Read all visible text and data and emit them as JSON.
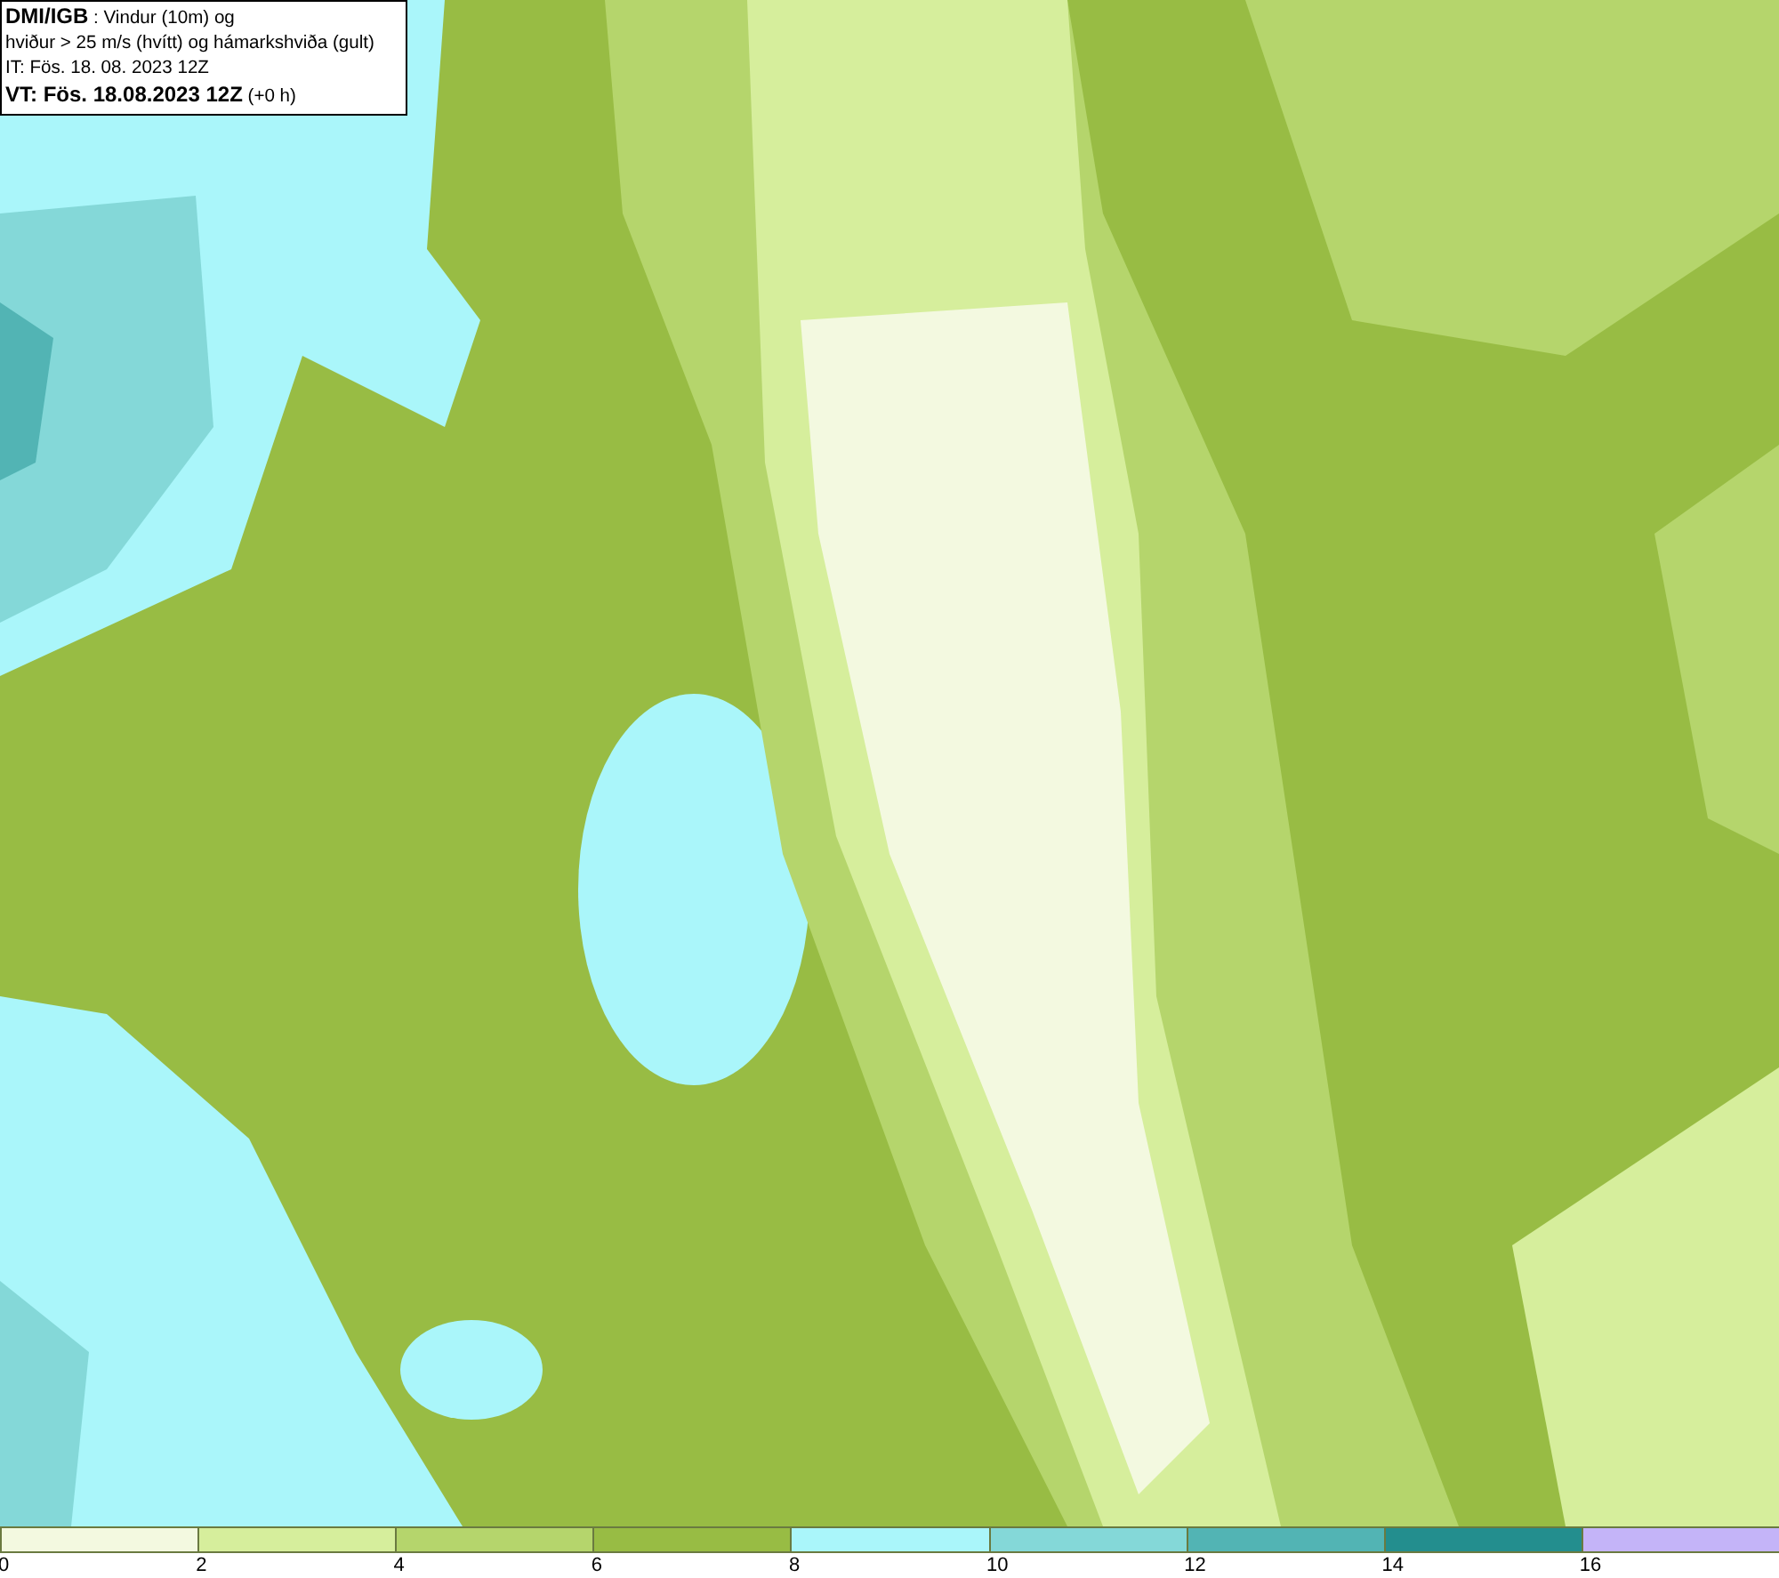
{
  "title_box": {
    "source": "DMI/IGB",
    "heading": ": Vindur (10m) og",
    "subtitle": "hviður > 25 m/s (hvítt) og hámarkshviða (gult)",
    "initial_time": "IT: Fös. 18. 08. 2023 12Z",
    "valid_time": "VT: Fös. 18.08.2023 12Z",
    "offset": "(+0 h)"
  },
  "legend": {
    "bands": [
      {
        "color": "#f3f9e0",
        "label": "0"
      },
      {
        "color": "#d6ee9c",
        "label": "2"
      },
      {
        "color": "#b5d56c",
        "label": "4"
      },
      {
        "color": "#98bc44",
        "label": "6"
      },
      {
        "color": "#aaf6fa",
        "label": "8"
      },
      {
        "color": "#84d8d8",
        "label": "10"
      },
      {
        "color": "#52b4b4",
        "label": "12"
      },
      {
        "color": "#238e8e",
        "label": "14"
      },
      {
        "color": "#c4b4f8",
        "label": "16"
      }
    ]
  }
}
